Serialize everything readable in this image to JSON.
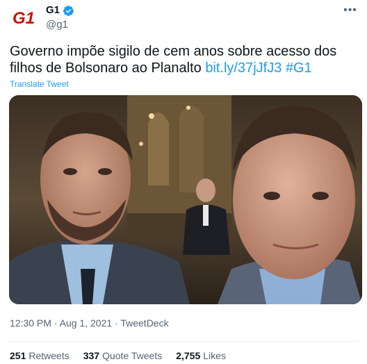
{
  "account": {
    "name": "G1",
    "handle": "@g1",
    "logo_text": "G1"
  },
  "tweet": {
    "text": "Governo impõe sigilo de cem anos sobre acesso dos filhos de Bolsonaro ao Planalto ",
    "link": "bit.ly/37jJfJ3",
    "hashtag": "#G1",
    "translate_label": "Translate Tweet"
  },
  "meta": {
    "time": "12:30 PM",
    "date": "Aug 1, 2021",
    "source": "TweetDeck",
    "separator": "·"
  },
  "stats": {
    "retweets_count": "251",
    "retweets_label": "Retweets",
    "quotes_count": "337",
    "quotes_label": "Quote Tweets",
    "likes_count": "2,755",
    "likes_label": "Likes"
  },
  "icons": {
    "more": "more-options-icon",
    "verified": "verified-badge-icon"
  },
  "colors": {
    "brand_red": "#c4170c",
    "link_blue": "#1d9bf0",
    "text_primary": "#0f1419",
    "text_secondary": "#536471"
  }
}
